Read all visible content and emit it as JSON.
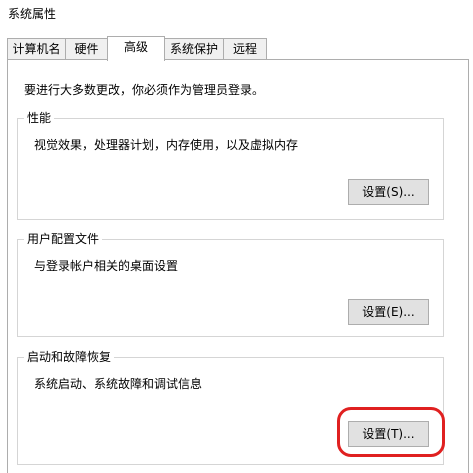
{
  "window": {
    "title": "系统属性"
  },
  "tabs": [
    {
      "label": "计算机名",
      "active": false
    },
    {
      "label": "硬件",
      "active": false
    },
    {
      "label": "高级",
      "active": true
    },
    {
      "label": "系统保护",
      "active": false
    },
    {
      "label": "远程",
      "active": false
    }
  ],
  "advanced": {
    "admin_note": "要进行大多数更改，你必须作为管理员登录。",
    "performance": {
      "title": "性能",
      "description": "视觉效果，处理器计划，内存使用，以及虚拟内存",
      "button_label": "设置(S)..."
    },
    "user_profiles": {
      "title": "用户配置文件",
      "description": "与登录帐户相关的桌面设置",
      "button_label": "设置(E)..."
    },
    "startup_recovery": {
      "title": "启动和故障恢复",
      "description": "系统启动、系统故障和调试信息",
      "button_label": "设置(T)..."
    }
  },
  "annotation": {
    "highlight_color": "#e02020"
  }
}
